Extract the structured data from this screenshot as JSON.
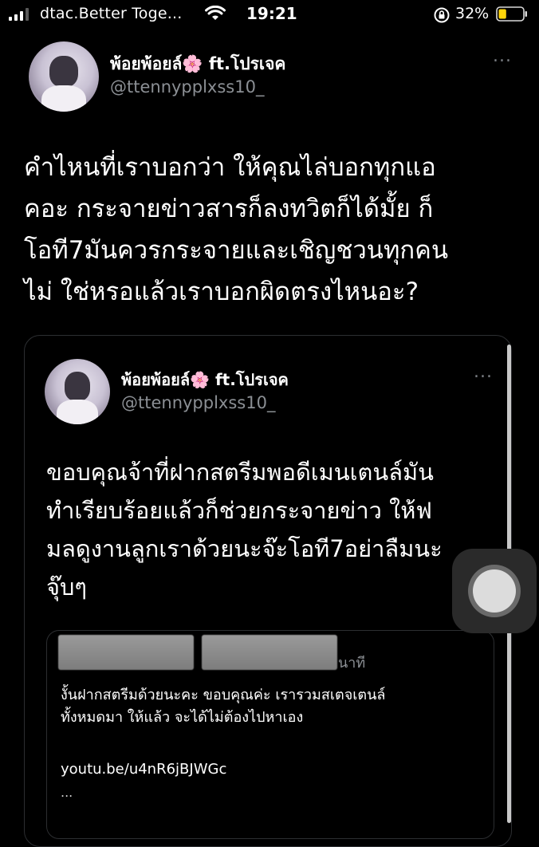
{
  "status_bar": {
    "carrier": "dtac.Better Toge...",
    "time": "19:21",
    "battery_percent": "32%",
    "battery_level": 0.32
  },
  "tweet": {
    "display_name": "พ้อยพ้อยล์🌸 ft.โปรเจค",
    "handle": "@ttennypplxss10_",
    "more_icon": "...",
    "lines": [
      "คำไหนที่เราบอกว่า ให้คุณไล่บอกทุกแอ",
      "คอะ กระจายข่าวสารก็ลงทวิตก็ได้มั้ย ก็",
      "โอที7มันควรกระจายและเชิญชวนทุกคน",
      "ไม่ ใช่หรอแล้วเราบอกผิดตรงไหนอะ?"
    ]
  },
  "quoted": {
    "display_name": "พ้อยพ้อยล์🌸 ft.โปรเจค",
    "handle": "@ttennypplxss10_",
    "more_icon": "...",
    "lines": [
      "ขอบคุณจ้าที่ฝากสตรีมพอดีเมนเตนล์มัน",
      "ทำเรียบร้อยแล้วก็ช่วยกระจายข่าว ให้ฟ",
      "มลดูงานลูกเราด้วยนะจ๊ะโอที7อย่าลืมนะ",
      "จุ๊บๆ"
    ]
  },
  "nested": {
    "time_suffix": "นาที",
    "lines": [
      "งั้นฝากสตรีมด้วยนะคะ ขอบคุณค่ะ เรารวมสเตจเตนล์",
      "ทั้งหมดมา ให้แล้ว จะได้ไม่ต้องไปหาเอง"
    ],
    "link": "youtu.be/u4nR6jBJWGc",
    "ellipsis": "..."
  }
}
